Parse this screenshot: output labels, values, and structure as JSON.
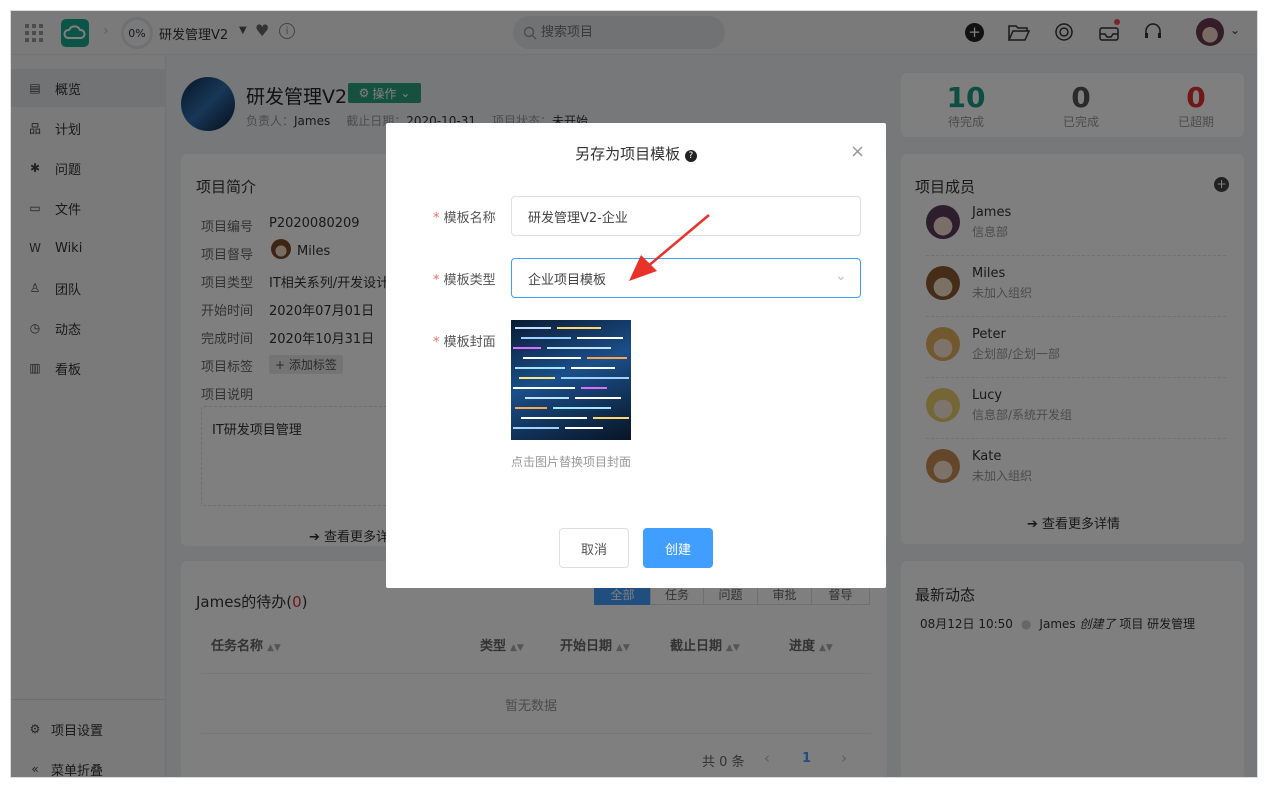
{
  "header": {
    "progress": "0%",
    "project_name": "研发管理V2",
    "search_placeholder": "搜索项目"
  },
  "sidebar": {
    "items": [
      {
        "label": "概览",
        "icon": "overview-icon"
      },
      {
        "label": "计划",
        "icon": "plan-icon"
      },
      {
        "label": "问题",
        "icon": "bug-icon"
      },
      {
        "label": "文件",
        "icon": "folder-icon"
      },
      {
        "label": "Wiki",
        "icon": "wiki-icon"
      },
      {
        "label": "团队",
        "icon": "team-icon"
      },
      {
        "label": "动态",
        "icon": "activity-icon"
      },
      {
        "label": "看板",
        "icon": "board-icon"
      }
    ],
    "settings": "项目设置",
    "collapse": "菜单折叠"
  },
  "project": {
    "title": "研发管理V2",
    "action": "操作",
    "owner_label": "负责人：",
    "owner": "James",
    "deadline_label": "截止日期：",
    "deadline": "2020-10-31",
    "status_label": "项目状态：",
    "status": "未开始"
  },
  "stats": [
    {
      "value": "10",
      "label": "待完成",
      "color": "#1a9a84"
    },
    {
      "value": "0",
      "label": "已完成",
      "color": "#555555"
    },
    {
      "value": "0",
      "label": "已超期",
      "color": "#e02e2e"
    }
  ],
  "intro": {
    "title": "项目简介",
    "rows": [
      {
        "label": "项目编号",
        "value": "P2020080209"
      },
      {
        "label": "项目督导",
        "value": "Miles"
      },
      {
        "label": "项目类型",
        "value": "IT相关系列/开发设计"
      },
      {
        "label": "开始时间",
        "value": "2020年07月01日"
      },
      {
        "label": "完成时间",
        "value": "2020年10月31日"
      },
      {
        "label": "项目标签",
        "value": "+ 添加标签"
      },
      {
        "label": "项目说明",
        "value": ""
      }
    ],
    "description": "IT研发项目管理",
    "more": "查看更多详情"
  },
  "todo": {
    "title_prefix": "James的待办(",
    "count": "0",
    "title_suffix": ")",
    "tabs": [
      "全部",
      "任务",
      "问题",
      "审批",
      "督导"
    ],
    "columns": [
      "任务名称",
      "类型",
      "开始日期",
      "截止日期",
      "进度"
    ],
    "empty": "暂无数据",
    "total": "共 0 条",
    "page": "1"
  },
  "members": {
    "title": "项目成员",
    "list": [
      {
        "name": "James",
        "dept": "信息部"
      },
      {
        "name": "Miles",
        "dept": "未加入组织"
      },
      {
        "name": "Peter",
        "dept": "企划部/企划一部"
      },
      {
        "name": "Lucy",
        "dept": "信息部/系统开发组"
      },
      {
        "name": "Kate",
        "dept": "未加入组织"
      }
    ],
    "more": "查看更多详情"
  },
  "activity": {
    "title": "最新动态",
    "items": [
      {
        "time": "08月12日 10:50",
        "user": "James",
        "verb": "创建了",
        "text": "项目 研发管理"
      }
    ]
  },
  "modal": {
    "title": "另存为项目模板",
    "name_label": "模板名称",
    "name_value": "研发管理V2-企业",
    "type_label": "模板类型",
    "type_value": "企业项目模板",
    "cover_label": "模板封面",
    "cover_hint": "点击图片替换项目封面",
    "cancel": "取消",
    "create": "创建",
    "accent": "#409eff"
  }
}
